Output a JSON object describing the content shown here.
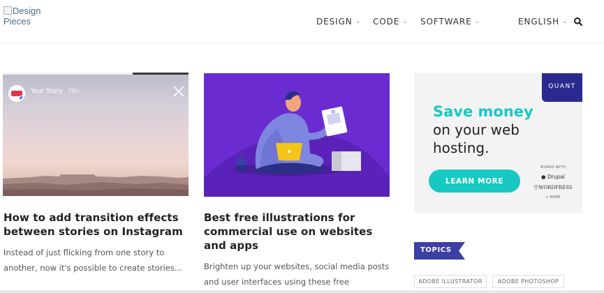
{
  "header": {
    "logo_alt": "Design Pieces",
    "nav": [
      {
        "label": "DESIGN"
      },
      {
        "label": "CODE"
      },
      {
        "label": "SOFTWARE"
      }
    ],
    "language": "ENGLISH",
    "chevron": "⌄"
  },
  "cards": [
    {
      "title": "How to add transition effects between stories on Instagram",
      "excerpt": "Instead of just flicking from one story to another, now it's possible to create stories...",
      "story": {
        "user": "Your Story",
        "time": "38s",
        "progress": 0.7
      }
    },
    {
      "title": "Best free illustrations for commercial use on websites and apps",
      "excerpt": "Brighten up your websites, social media posts and user interfaces using these free resources."
    }
  ],
  "ad": {
    "brand": "QUANT",
    "headline": "Save money",
    "subline": "on your web hosting.",
    "button": "LEARN MORE",
    "works_with": "WORKS WITH",
    "drupal": "Drupal",
    "wordpress": "WORDPRESS",
    "more": "+ MORE"
  },
  "sidebar": {
    "topics_label": "TOPICS",
    "tags": [
      "ADOBE ILLUSTRATOR",
      "ADOBE PHOTOSHOP"
    ]
  },
  "colors": {
    "accent": "#3c3fa3",
    "teal": "#17c9c2",
    "illustration_bg": "#6a2cd0"
  }
}
